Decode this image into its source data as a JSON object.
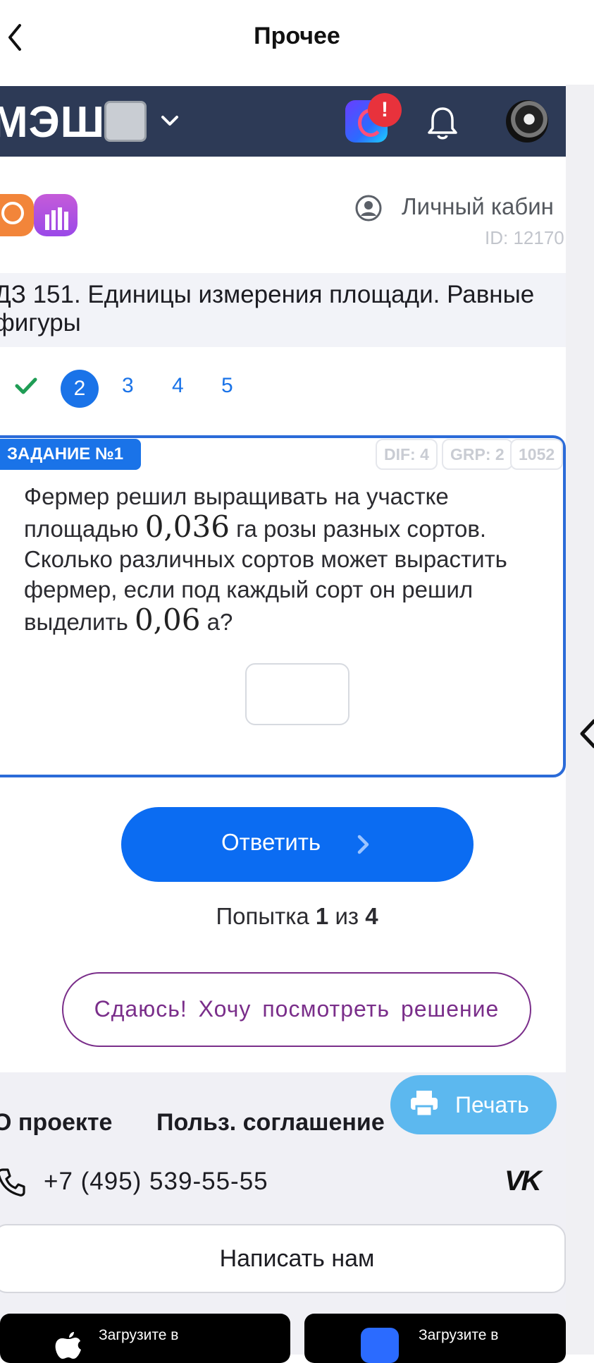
{
  "ios_nav": {
    "title": "Прочее"
  },
  "header": {
    "logo_text": "МЭШ",
    "notification_count": "!"
  },
  "brand": {
    "cabinet_label": "Личный кабин",
    "user_id": "ID: 12170"
  },
  "lesson": {
    "title": "ДЗ 151. Единицы измерения площади. Равные фигуры"
  },
  "pager": {
    "pages": [
      "2",
      "3",
      "4",
      "5"
    ],
    "active": "2"
  },
  "task": {
    "badge": "ЗАДАНИЕ №1",
    "tags": [
      "DIF: 4",
      "GRP: 2",
      "1052"
    ],
    "text_1": "Фермер решил выращивать на участке площадью ",
    "value_1": "0,036",
    "text_2": " га розы разных сортов. Сколько различных сортов может вырастить фермер, если под каждый сорт он решил выделить ",
    "value_2": "0,06",
    "text_3": " а?"
  },
  "actions": {
    "answer_label": "Ответить",
    "attempt_prefix": "Попытка ",
    "attempt_current": "1",
    "attempt_middle": " из ",
    "attempt_total": "4",
    "giveup_label": "Сдаюсь! Хочу посмотреть решение"
  },
  "footer": {
    "print_label": "Печать",
    "about_label": "О проекте",
    "agreement_label": "Польз. соглашение",
    "phone": "+7 (495) 539-55-55",
    "vk": "VK",
    "write_label": "Написать нам",
    "store_1": "Загрузите в",
    "store_2": "Загрузите в"
  },
  "colors": {
    "primary": "#0b6cf2",
    "header_bg": "#2d3a56",
    "giveup": "#7a2e8a",
    "print_bg": "#5cb8ef"
  }
}
